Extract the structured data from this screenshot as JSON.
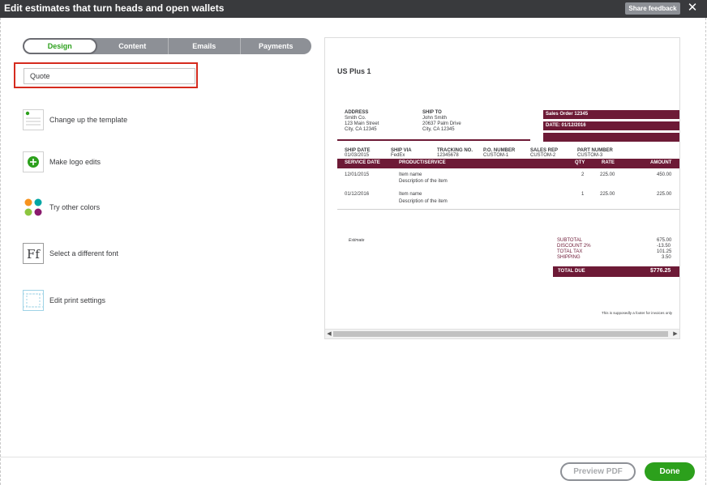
{
  "dialog": {
    "title": "Edit estimates that turn heads and open wallets",
    "feedback_label": "Share feedback",
    "close_glyph": "✕"
  },
  "tabs": [
    "Design",
    "Content",
    "Emails",
    "Payments"
  ],
  "template_name": {
    "value": "Quote"
  },
  "options": [
    {
      "label": "Change up the template"
    },
    {
      "label": "Make logo edits"
    },
    {
      "label": "Try other colors"
    },
    {
      "label": "Select a different font"
    },
    {
      "label": "Edit print settings"
    }
  ],
  "font_icon_text": "Ff",
  "colors": {
    "accent": "#6d1a36",
    "green": "#2ca01c",
    "dot_orange": "#f7931e",
    "dot_teal": "#00a6a4",
    "dot_lime": "#8cc63f",
    "dot_purple": "#8a1a6d"
  },
  "preview": {
    "company": "US Plus 1",
    "address": {
      "label": "ADDRESS",
      "lines": [
        "Smith Co.",
        "123 Main Street",
        "City, CA 12345"
      ]
    },
    "ship_to": {
      "label": "SHIP TO",
      "lines": [
        "John Smith",
        "20637 Palm Drive",
        "City, CA 12345"
      ]
    },
    "sales_order": "Sales Order  12345",
    "date": "DATE:  01/12/2016",
    "shipping_headers": [
      "SHIP DATE",
      "SHIP VIA",
      "TRACKING NO.",
      "P.O. NUMBER",
      "SALES REP",
      "PART NUMBER"
    ],
    "shipping_values": [
      "01/03/2015",
      "FedEx",
      "12345678",
      "CUSTOM-1",
      "CUSTOM-2",
      "CUSTOM-3"
    ],
    "table_headers": [
      "SERVICE DATE",
      "PRODUCT/SERVICE",
      "QTY",
      "RATE",
      "AMOUNT"
    ],
    "rows": [
      {
        "date": "12/01/2015",
        "item": "Item name",
        "desc": "Description of the item",
        "qty": "2",
        "rate": "225.00",
        "amount": "450.00"
      },
      {
        "date": "01/12/2016",
        "item": "Item name",
        "desc": "Description of the item",
        "qty": "1",
        "rate": "225.00",
        "amount": "225.00"
      }
    ],
    "estimate_label": "Estimate",
    "totals": [
      {
        "label": "SUBTOTAL",
        "value": "675.00"
      },
      {
        "label": "DISCOUNT 2%",
        "value": "-13.50"
      },
      {
        "label": "TOTAL TAX",
        "value": "101.25"
      },
      {
        "label": "SHIPPING",
        "value": "3.50"
      }
    ],
    "total_due_label": "TOTAL DUE",
    "total_due_value": "$776.25",
    "footer_note": "This is supposedly a footer for invoices only",
    "scroll_left": "◀",
    "scroll_right": "▶"
  },
  "footer": {
    "preview_pdf": "Preview PDF",
    "done": "Done"
  }
}
